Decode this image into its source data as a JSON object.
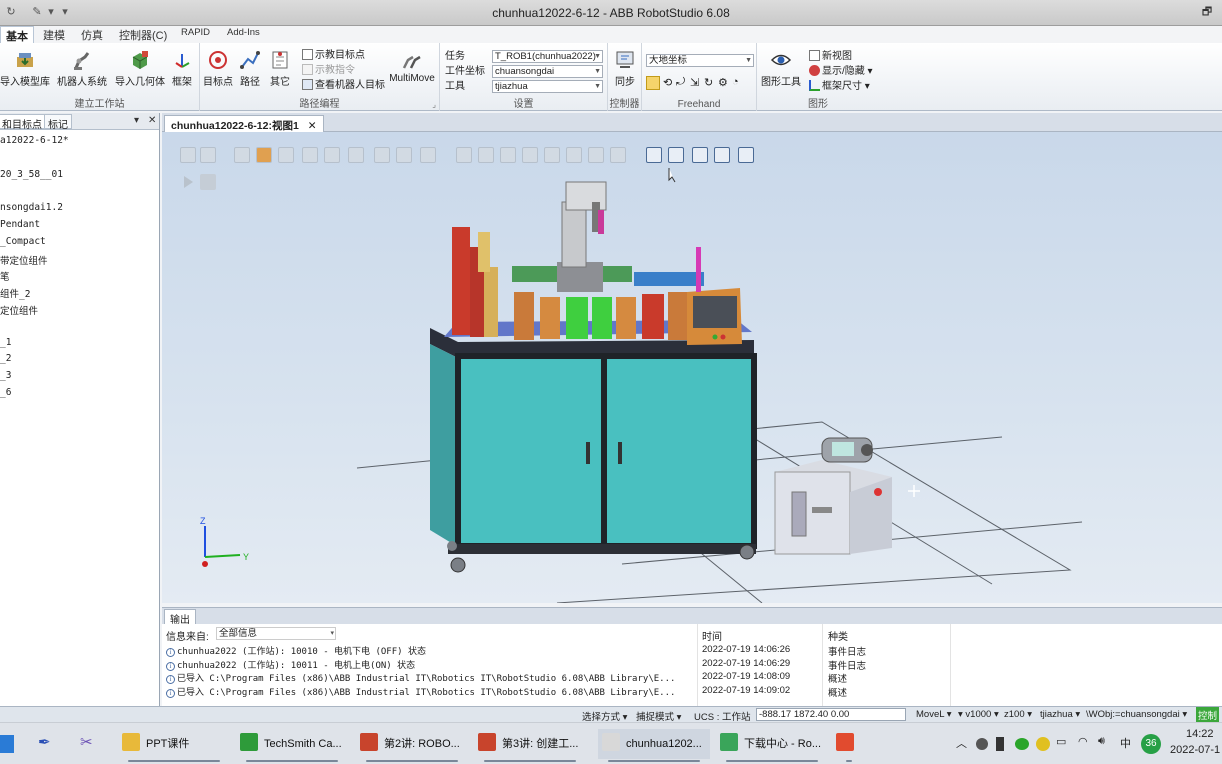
{
  "window": {
    "title": "chunhua12022-6-12 - ABB RobotStudio 6.08",
    "restore_label": "🗗"
  },
  "ribbon_tabs": [
    "基本",
    "建模",
    "仿真",
    "控制器(C)",
    "RAPID",
    "Add-Ins"
  ],
  "ribbon": {
    "build_station": {
      "label": "建立工作站",
      "buttons": [
        "导入模型库",
        "机器人系统",
        "导入几何体",
        "框架"
      ]
    },
    "path_programming": {
      "label": "路径编程",
      "buttons": [
        "目标点",
        "路径",
        "其它"
      ],
      "small": [
        "示教目标点",
        "示教指令",
        "查看机器人目标"
      ],
      "multimove": "MultiMove"
    },
    "settings": {
      "label": "设置",
      "rows": [
        {
          "label": "任务",
          "value": "T_ROB1(chunhua2022)"
        },
        {
          "label": "工件坐标",
          "value": "chuansongdai"
        },
        {
          "label": "工具",
          "value": "tjiazhua"
        }
      ]
    },
    "controller": {
      "label": "控制器",
      "button": "同步"
    },
    "freehand": {
      "label": "Freehand",
      "frame_value": "大地坐标"
    },
    "graphics": {
      "label": "图形",
      "button": "图形工具",
      "small": [
        "新视图",
        "显示/隐藏",
        "框架尺寸"
      ]
    }
  },
  "left_panel": {
    "tabs": [
      "和目标点",
      "标记"
    ],
    "tree": [
      "a12022-6-12*",
      "",
      "20_3_58__01",
      "",
      "nsongdai1.2",
      "Pendant",
      "_Compact",
      "带定位组件",
      "笔",
      "组件_2",
      "定位组件",
      "",
      "_1",
      "_2",
      "_3",
      "_6"
    ]
  },
  "view": {
    "tab_label": "chunhua12022-6-12:视图1",
    "axis_z": "Z",
    "axis_y": "Y"
  },
  "output": {
    "tab_label": "输出",
    "source_label": "信息来自:",
    "source_value": "全部信息",
    "col_time": "时间",
    "col_category": "种类",
    "rows": [
      {
        "msg": "chunhua2022 (工作站): 10010 - 电机下电 (OFF) 状态",
        "time": "2022-07-19 14:06:26",
        "cat": "事件日志"
      },
      {
        "msg": "chunhua2022 (工作站): 10011 - 电机上电(ON) 状态",
        "time": "2022-07-19 14:06:29",
        "cat": "事件日志"
      },
      {
        "msg": "已导入 C:\\Program Files (x86)\\ABB Industrial IT\\Robotics IT\\RobotStudio 6.08\\ABB Library\\E...",
        "time": "2022-07-19 14:08:09",
        "cat": "概述"
      },
      {
        "msg": "已导入 C:\\Program Files (x86)\\ABB Industrial IT\\Robotics IT\\RobotStudio 6.08\\ABB Library\\E...",
        "time": "2022-07-19 14:09:02",
        "cat": "概述"
      }
    ]
  },
  "statusbar": {
    "select_mode": "选择方式",
    "snap_mode": "捕捉模式",
    "ucs": "UCS : 工作站",
    "coords": "-888.17   1872.40   0.00",
    "move": "MoveL",
    "speed": "v1000",
    "zone": "z100",
    "tool": "tjiazhua",
    "wobj": "\\WObj:=chuansongdai",
    "control": "控制"
  },
  "taskbar": {
    "items": [
      {
        "label": "PPT课件",
        "color": "#e8b93a"
      },
      {
        "label": "TechSmith Ca...",
        "color": "#2e9b3a"
      },
      {
        "label": "第2讲: ROBO...",
        "color": "#c8442c"
      },
      {
        "label": "第3讲: 创建工...",
        "color": "#c8442c"
      },
      {
        "label": "chunhua1202...",
        "color": "#d8d8d8"
      },
      {
        "label": "下载中心 - Ro...",
        "color": "#3aa55a"
      }
    ],
    "ime": "中",
    "badge": "36",
    "time": "14:22",
    "date": "2022-07-1"
  }
}
